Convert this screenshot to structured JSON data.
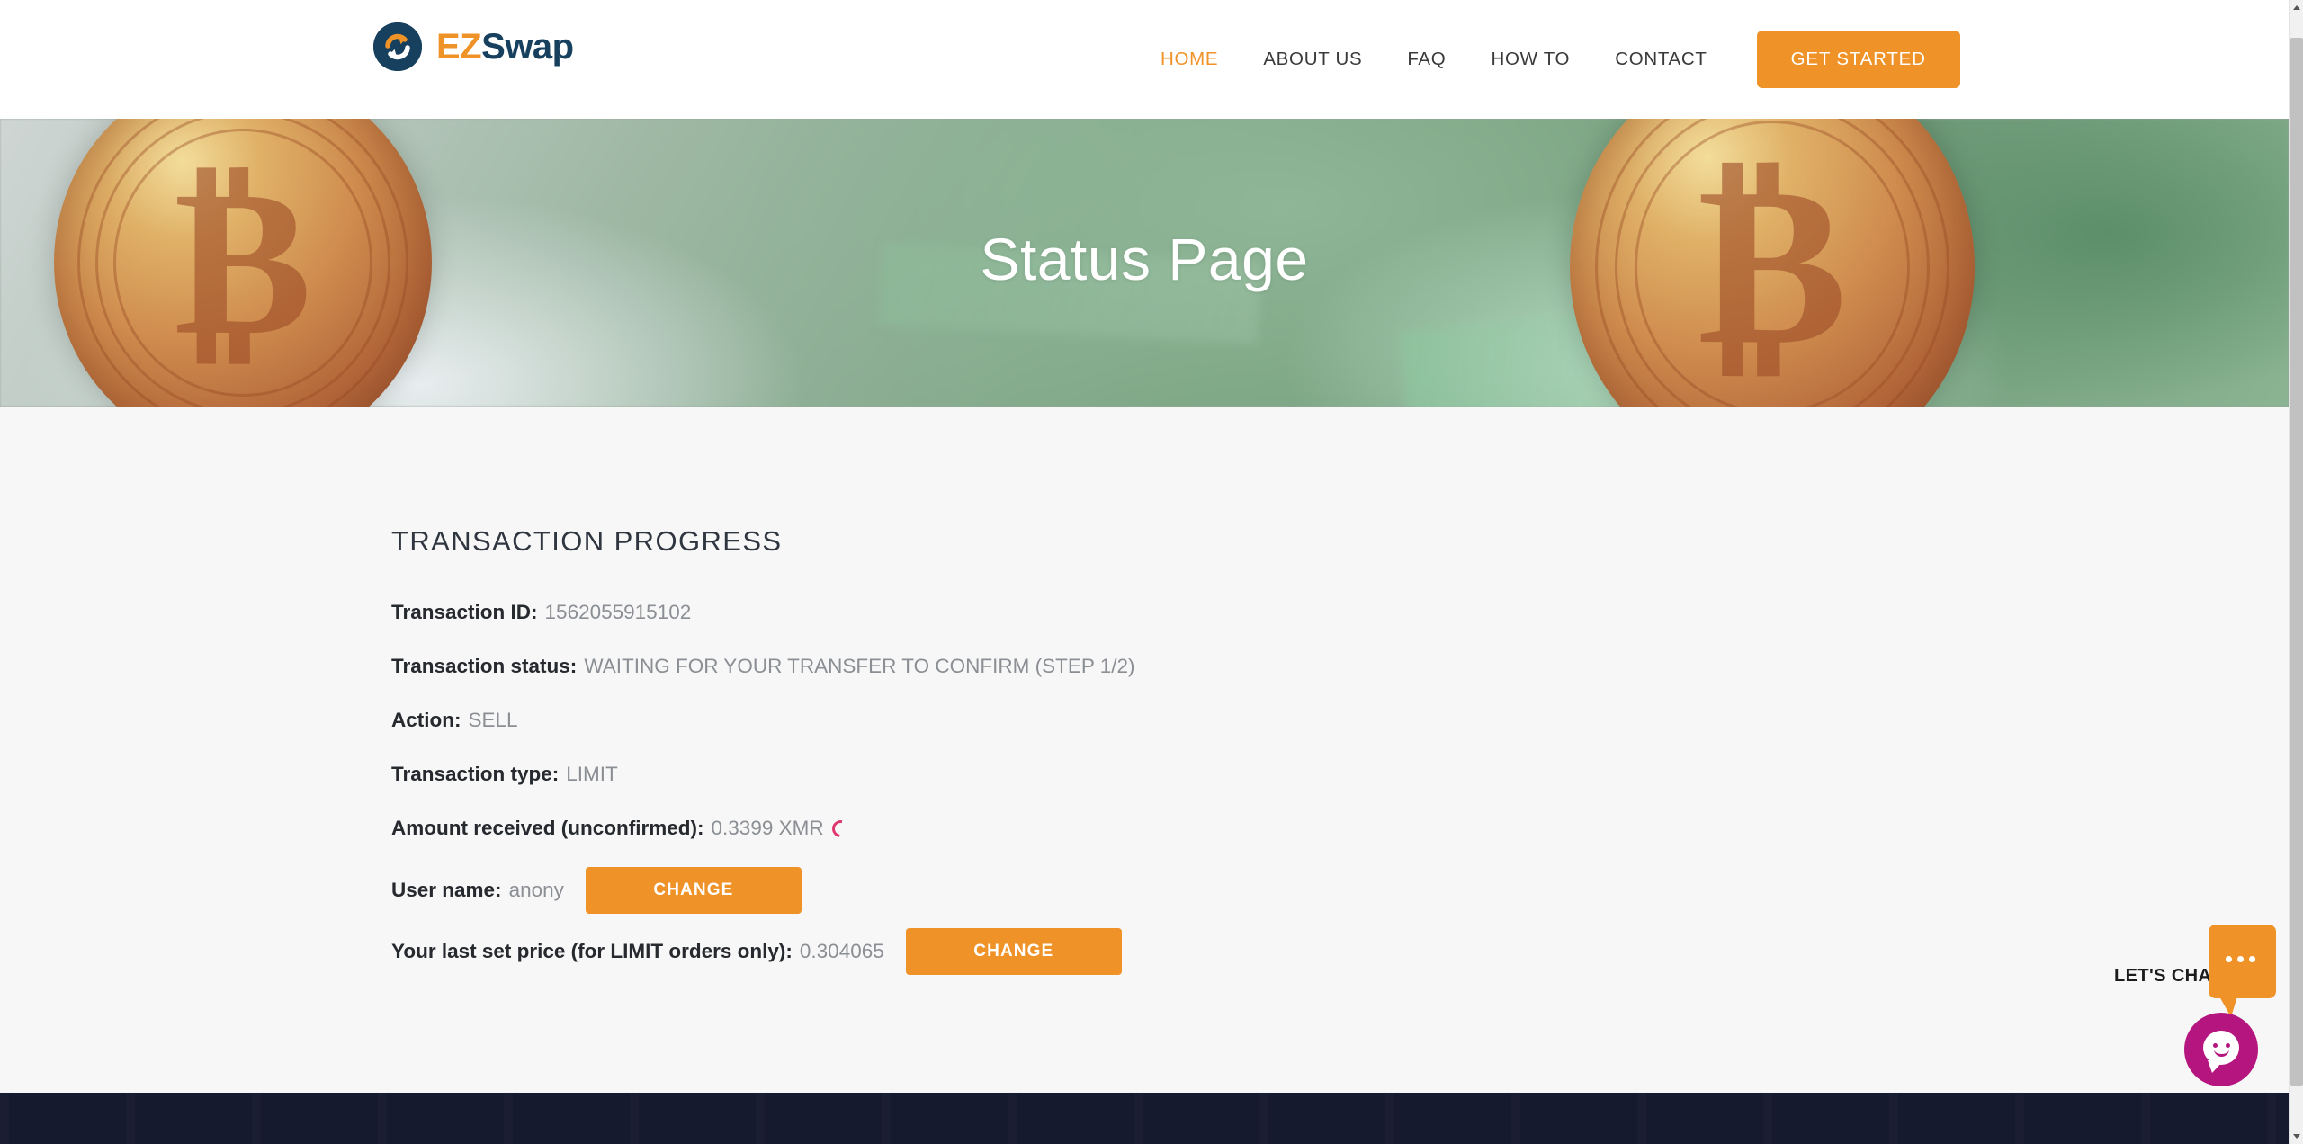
{
  "brand": {
    "logo_ez": "EZ",
    "logo_s": "S",
    "logo_wap": "wap",
    "mark_icon": "swap-circle-icon",
    "navy": "#17405e",
    "orange": "#ef9227"
  },
  "nav": {
    "items": [
      {
        "label": "HOME",
        "active": true
      },
      {
        "label": "ABOUT US",
        "active": false
      },
      {
        "label": "FAQ",
        "active": false
      },
      {
        "label": "HOW TO",
        "active": false
      },
      {
        "label": "CONTACT",
        "active": false
      }
    ],
    "cta_label": "GET STARTED"
  },
  "hero": {
    "title": "Status Page"
  },
  "main": {
    "section_title": "TRANSACTION PROGRESS",
    "rows": [
      {
        "label": "Transaction ID:",
        "value": "1562055915102"
      },
      {
        "label": "Transaction status:",
        "value": "WAITING FOR YOUR TRANSFER TO CONFIRM (STEP 1/2)"
      },
      {
        "label": "Action:",
        "value": "SELL"
      },
      {
        "label": "Transaction type:",
        "value": "LIMIT"
      },
      {
        "label": "Amount received (unconfirmed):",
        "value": "0.3399 XMR"
      },
      {
        "label": "User name:",
        "value": "anony"
      },
      {
        "label": "Your last set price (for LIMIT orders only):",
        "value": "0.304065"
      }
    ],
    "spinner_icon": "loading-spinner-icon",
    "spinner_color": "#e0366f",
    "change_username_label": "CHANGE",
    "change_price_label": "CHANGE"
  },
  "chat": {
    "label": "LET'S CHAT!",
    "bubble_dots": "•••",
    "bubble_icon": "speech-bubble-icon",
    "fab_icon": "chat-smiley-icon",
    "fab_color": "#b5157e",
    "bubble_color": "#ef9227"
  },
  "scrollbar": {
    "up_icon": "scroll-up-arrow-icon",
    "down_icon": "scroll-down-arrow-icon"
  }
}
